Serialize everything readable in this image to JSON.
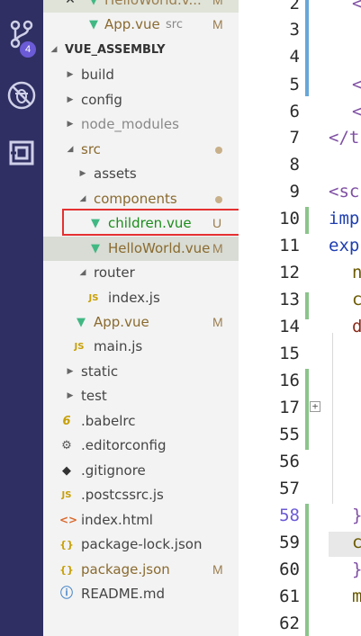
{
  "activity": {
    "scm_badge": "4",
    "icons": [
      "source-control-icon",
      "no-debug-icon",
      "extensions-icon"
    ]
  },
  "explorer": {
    "open_editor_partial": {
      "label": "HelloWorld.v...",
      "status": "M"
    },
    "open_editor_app": {
      "label": "App.vue",
      "path": "src",
      "status": "M"
    },
    "section": "VUE_ASSEMBLY",
    "tree": [
      {
        "label": "build"
      },
      {
        "label": "config"
      },
      {
        "label": "node_modules"
      },
      {
        "label": "src"
      },
      {
        "label": "assets"
      },
      {
        "label": "components"
      },
      {
        "label": "children.vue",
        "status": "U"
      },
      {
        "label": "HelloWorld.vue",
        "status": "M"
      },
      {
        "label": "router"
      },
      {
        "label": "index.js",
        "icon": "JS"
      },
      {
        "label": "App.vue",
        "status": "M"
      },
      {
        "label": "main.js",
        "icon": "JS"
      },
      {
        "label": "static"
      },
      {
        "label": "test"
      },
      {
        "label": ".babelrc",
        "icon": "6"
      },
      {
        "label": ".editorconfig"
      },
      {
        "label": ".gitignore"
      },
      {
        "label": ".postcssrc.js",
        "icon": "JS"
      },
      {
        "label": "index.html"
      },
      {
        "label": "package-lock.json",
        "icon": "{}"
      },
      {
        "label": "package.json",
        "icon": "{}",
        "status": "M"
      },
      {
        "label": "README.md"
      }
    ]
  },
  "editor": {
    "line_numbers": [
      "2",
      "3",
      "4",
      "5",
      "6",
      "7",
      "8",
      "9",
      "10",
      "11",
      "12",
      "13",
      "14",
      "15",
      "16",
      "17",
      "55",
      "56",
      "57",
      "58",
      "59",
      "60",
      "61",
      "62"
    ],
    "code": {
      "l2": "<",
      "l5": "<",
      "l6": "<",
      "l7": "</t",
      "l9": "<sc",
      "l10": "imp",
      "l11": "exp",
      "l12": "n",
      "l13": "c",
      "l14": "d",
      "l58": "}",
      "l59": "c",
      "l60": "}",
      "l61": "m"
    },
    "fold_glyph": "+"
  }
}
